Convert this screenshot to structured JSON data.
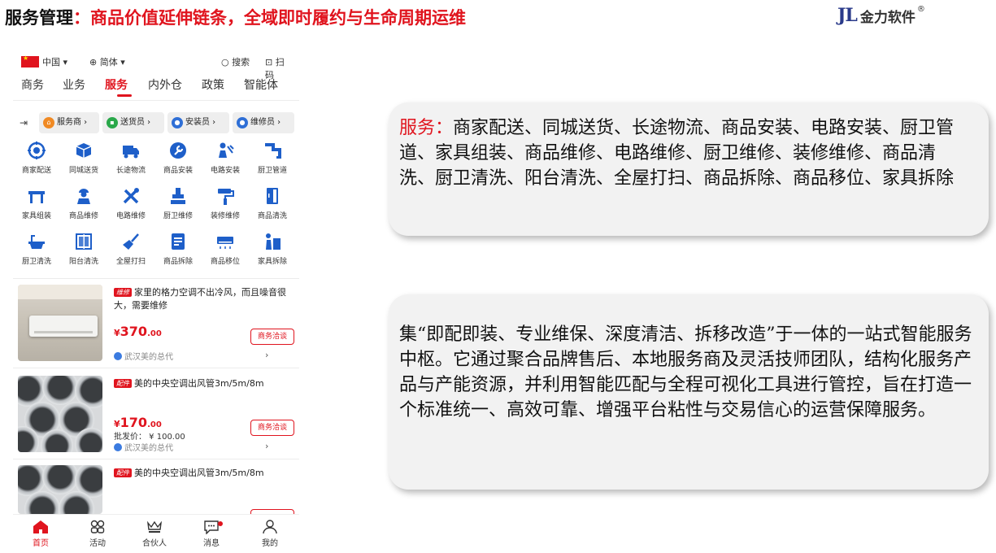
{
  "slide": {
    "title_prefix": "服务管理",
    "title_colon": "：",
    "title_main": "商品价值延伸链条，全域即时履约与生命周期运维",
    "brand_mark": "JL",
    "brand_name": "金力软件",
    "brand_reg": "®"
  },
  "app": {
    "region": "中国",
    "language": "简体",
    "search_label": "搜索",
    "scan_label": "扫码",
    "tabs": [
      "商务",
      "业务",
      "服务",
      "内外仓",
      "政策",
      "智能体"
    ],
    "active_tab": "服务",
    "roles": [
      "服务商",
      "送货员",
      "安装员",
      "维修员"
    ],
    "services": [
      {
        "label": "商家配送",
        "icon": "gear-pin-icon"
      },
      {
        "label": "同城送货",
        "icon": "box-icon"
      },
      {
        "label": "长途物流",
        "icon": "truck-icon"
      },
      {
        "label": "商品安装",
        "icon": "wrench-icon"
      },
      {
        "label": "电路安装",
        "icon": "electrician-icon"
      },
      {
        "label": "厨卫管道",
        "icon": "pipe-icon"
      },
      {
        "label": "家具组装",
        "icon": "table-icon"
      },
      {
        "label": "商品维修",
        "icon": "worker-icon"
      },
      {
        "label": "电路维修",
        "icon": "tools-icon"
      },
      {
        "label": "厨卫维修",
        "icon": "faucet-icon"
      },
      {
        "label": "装修维修",
        "icon": "paint-roller-icon"
      },
      {
        "label": "商品清洗",
        "icon": "fridge-icon"
      },
      {
        "label": "厨卫清洗",
        "icon": "bathtub-icon"
      },
      {
        "label": "阳台清洗",
        "icon": "window-icon"
      },
      {
        "label": "全屋打扫",
        "icon": "broom-icon"
      },
      {
        "label": "商品拆除",
        "icon": "document-icon"
      },
      {
        "label": "商品移位",
        "icon": "air-conditioner-icon"
      },
      {
        "label": "家具拆除",
        "icon": "mover-icon"
      }
    ],
    "products": [
      {
        "tag": "维修",
        "title": "家里的格力空调不出冷风，而且噪音很大，需要维修",
        "currency": "¥",
        "price_int": "370",
        "price_dec": ".00",
        "wholesale": "",
        "shop": "武汉美的总代",
        "action": "商务洽谈"
      },
      {
        "tag": "配件",
        "title": "美的中央空调出风管3m/5m/8m",
        "currency": "¥",
        "price_int": "170",
        "price_dec": ".00",
        "wholesale": "批发价： ¥ 100.00",
        "shop": "武汉美的总代",
        "action": "商务洽谈"
      },
      {
        "tag": "配件",
        "title": "美的中央空调出风管3m/5m/8m"
      }
    ],
    "bottom_nav": [
      {
        "label": "首页",
        "icon": "home-icon"
      },
      {
        "label": "活动",
        "icon": "activity-icon"
      },
      {
        "label": "合伙人",
        "icon": "partner-icon"
      },
      {
        "label": "消息",
        "icon": "message-icon"
      },
      {
        "label": "我的",
        "icon": "profile-icon"
      }
    ],
    "active_bottom": "首页"
  },
  "callouts": {
    "services_label": "服务：",
    "services_text": "商家配送、同城送货、长途物流、商品安装、电路安装、厨卫管道、家具组装、商品维修、电路维修、厨卫维修、装修维修、商品清洗、厨卫清洗、阳台清洗、全屋打扫、商品拆除、商品移位、家具拆除",
    "summary": "集“即配即装、专业维保、深度清洁、拆移改造”于一体的一站式智能服务中枢。它通过聚合品牌售后、本地服务商及灵活技师团队，结构化服务产品与产能资源，并利用智能匹配与全程可视化工具进行管控，旨在打造一个标准统一、高效可靠、增强平台粘性与交易信心的运营保障服务。"
  },
  "colors": {
    "accent_red": "#e0141e",
    "icon_blue": "#1e5fc9",
    "brand_blue": "#2a3a8a",
    "callout_bg": "#f2f2f2"
  }
}
